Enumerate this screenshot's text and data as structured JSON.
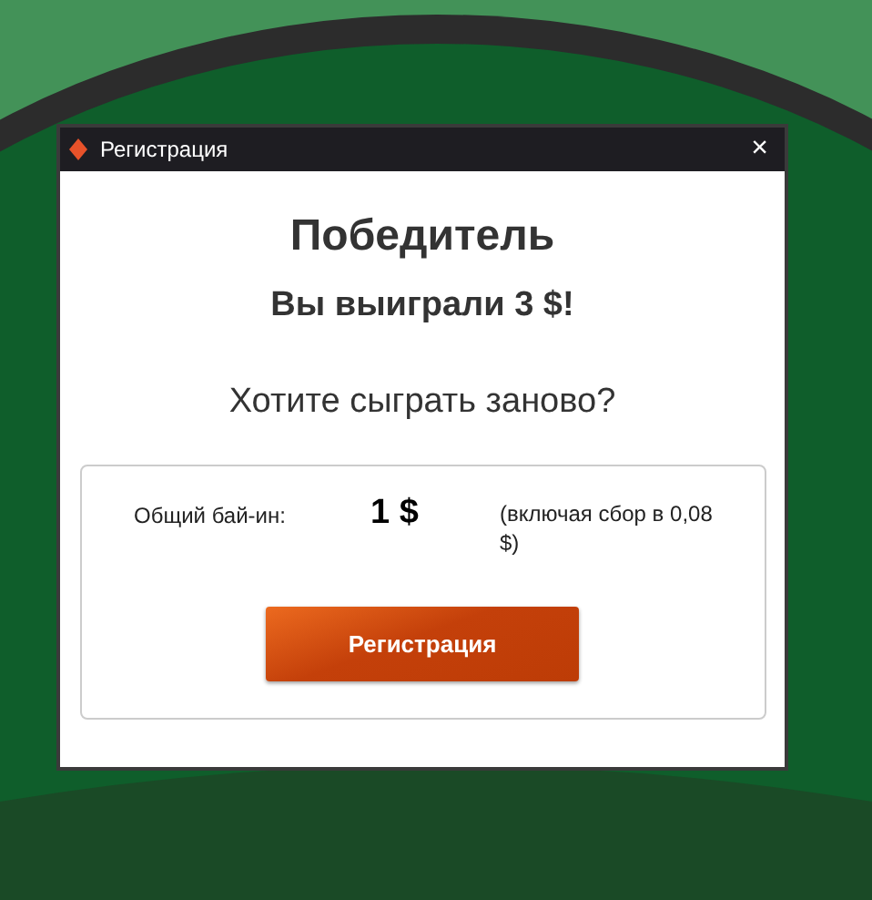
{
  "window": {
    "title": "Регистрация",
    "close": "×"
  },
  "heading": "Победитель",
  "prize": "Вы выиграли 3 $!",
  "question": "Хотите сыграть заново?",
  "buyin": {
    "label": "Общий бай-ин:",
    "amount": "1 $",
    "note": "(включая сбор в 0,08 $)"
  },
  "button": "Регистрация"
}
